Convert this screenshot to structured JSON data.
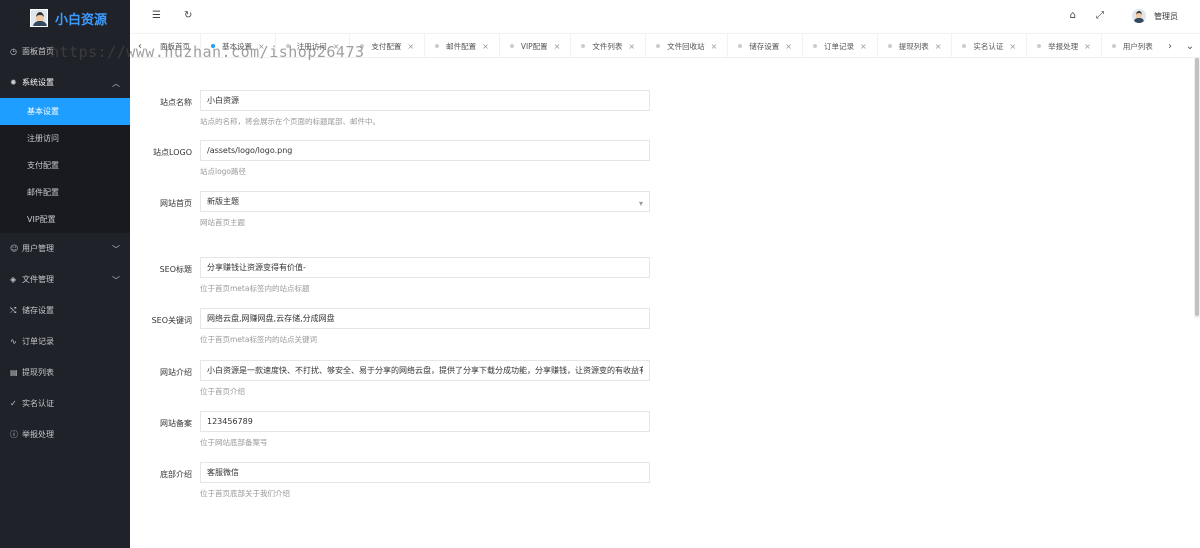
{
  "app": {
    "title": "小白资源"
  },
  "watermark": "https://www.huzhan.com/ishop26473",
  "sidebar": {
    "dashboard": "面板首页",
    "system_settings": "系统设置",
    "system_sub": [
      "基本设置",
      "注册访问",
      "支付配置",
      "邮件配置",
      "VIP配置"
    ],
    "user_mgmt": "用户管理",
    "file_mgmt": "文件管理",
    "storage": "储存设置",
    "orders": "订单记录",
    "withdraw": "提现列表",
    "realname": "实名认证",
    "report": "举报处理"
  },
  "topbar": {
    "user_name": "管理员"
  },
  "tabs": [
    "面板首页",
    "基本设置",
    "注册访问",
    "支付配置",
    "邮件配置",
    "VIP配置",
    "文件列表",
    "文件回收站",
    "储存设置",
    "订单记录",
    "提现列表",
    "实名认证",
    "举报处理",
    "用户列表"
  ],
  "form": {
    "site_name": {
      "label": "站点名称",
      "value": "小白资源",
      "help": "站点的名称，将会展示在个页面的标题尾部、邮件中。"
    },
    "site_logo": {
      "label": "站点LOGO",
      "value": "/assets/logo/logo.png",
      "help": "站点logo路径"
    },
    "site_home": {
      "label": "网站首页",
      "value": "新版主题",
      "help": "网站首页主题"
    },
    "seo_title": {
      "label": "SEO标题",
      "value": "分享赚钱让资源变得有价值-",
      "help": "位于首页meta标签内的站点标题"
    },
    "seo_keywords": {
      "label": "SEO关键词",
      "value": "网络云盘,网赚网盘,云存储,分成网盘",
      "help": "位于首页meta标签内的站点关键词"
    },
    "site_intro": {
      "label": "网站介绍",
      "value": "小白资源是一款速度快、不打扰、够安全、易于分享的网络云盘，提供了分享下载分成功能，分享赚钱，让资源变的有收益有价值",
      "help": "位于首页介绍"
    },
    "site_icp": {
      "label": "网站备案",
      "value": "123456789",
      "help": "位于网站底部备案号"
    },
    "footer_intro": {
      "label": "底部介绍",
      "value": "客服微信",
      "help": "位于首页底部关于我们介绍"
    }
  }
}
